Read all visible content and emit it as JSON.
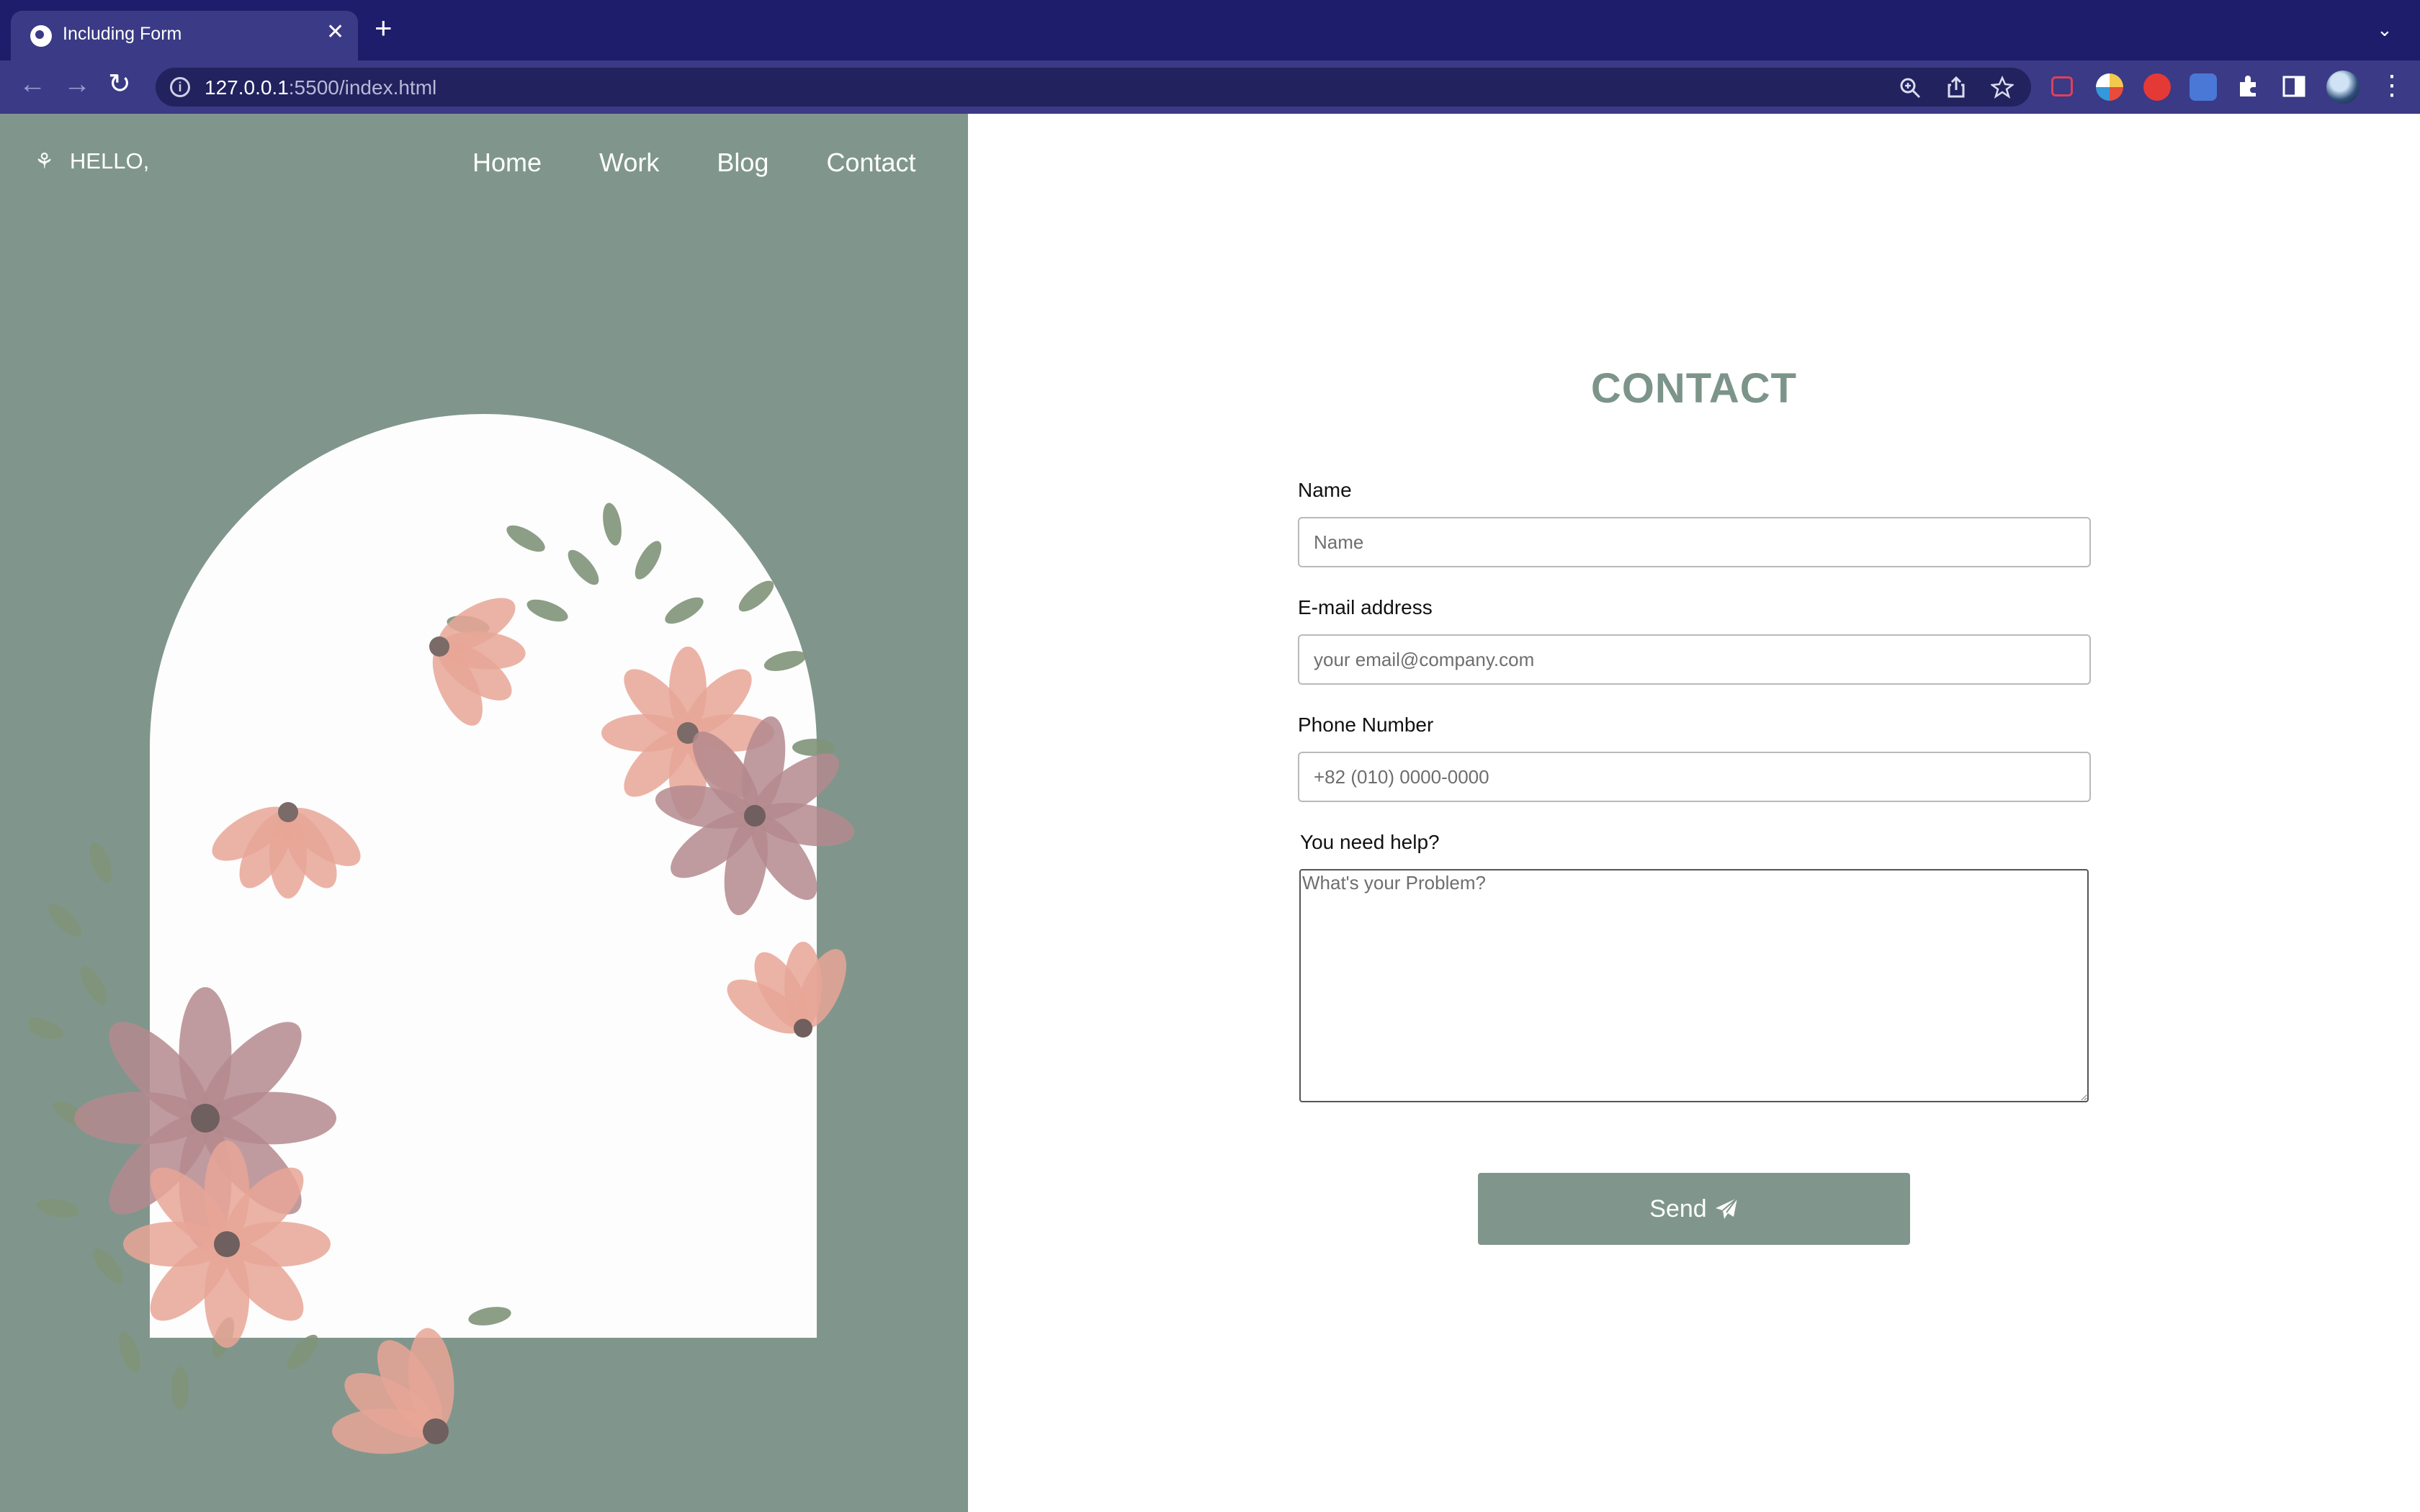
{
  "browser": {
    "tab_title": "Including Form",
    "tab_close": "✕",
    "new_tab": "+",
    "tab_dropdown": "⌄",
    "url_host": "127.0.0.1",
    "url_path": ":5500/index.html",
    "nav_back": "←",
    "nav_forward": "→",
    "nav_reload": "↻",
    "menu": "⋮"
  },
  "site": {
    "brand": "HELLO,",
    "nav": [
      "Home",
      "Work",
      "Blog",
      "Contact"
    ]
  },
  "contact": {
    "title": "CONTACT",
    "name_label": "Name",
    "name_placeholder": "Name",
    "email_label": "E-mail address",
    "email_placeholder": "your email@company.com",
    "phone_label": "Phone Number",
    "phone_placeholder": "+82 (010) 0000-0000",
    "help_label": "You need help?",
    "help_placeholder": "What's your Problem?",
    "send_label": "Send"
  },
  "colors": {
    "tabbar": "#1d1d6b",
    "toolbar": "#3a3a86",
    "sage": "#80968c",
    "title": "#7c9489"
  },
  "icons": [
    "globe-icon",
    "close-icon",
    "plus-icon",
    "back-arrow-icon",
    "forward-arrow-icon",
    "reload-icon",
    "info-icon",
    "zoom-icon",
    "share-icon",
    "star-icon",
    "extensions-icon",
    "sidepanel-icon",
    "profile-avatar",
    "menu-icon",
    "leaf-icon",
    "paper-plane-icon"
  ]
}
